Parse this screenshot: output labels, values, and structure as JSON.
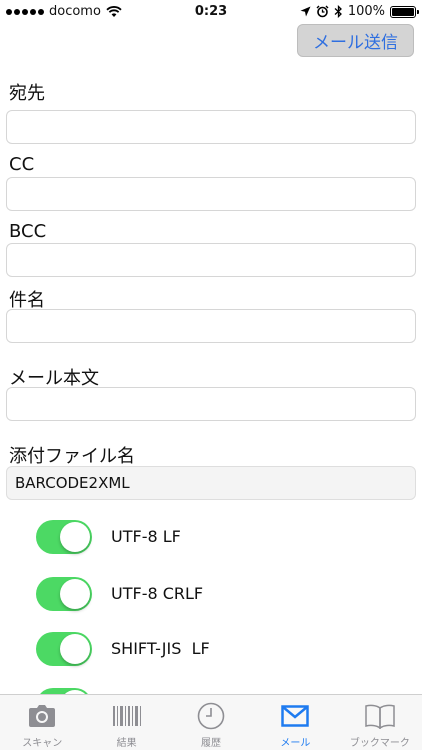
{
  "status_bar": {
    "carrier": "docomo",
    "time": "0:23",
    "battery": "100%",
    "battery_level": 1.0
  },
  "send_button": "メール送信",
  "form": {
    "to_label": "宛先",
    "cc_label": "CC",
    "bcc_label": "BCC",
    "subject_label": "件名",
    "body_label": "メール本文",
    "attachment_label": "添付ファイル名",
    "attachment_value": "BARCODE2XML"
  },
  "toggles": [
    {
      "label": "UTF-8 LF",
      "on": true
    },
    {
      "label": "UTF-8 CRLF",
      "on": true
    },
    {
      "label": "SHIFT-JIS  LF",
      "on": true
    }
  ],
  "tabs": [
    {
      "label": "スキャン",
      "icon": "camera-icon",
      "active": false
    },
    {
      "label": "結果",
      "icon": "barcode-icon",
      "active": false
    },
    {
      "label": "履歴",
      "icon": "clock-icon",
      "active": false
    },
    {
      "label": "メール",
      "icon": "mail-icon",
      "active": true
    },
    {
      "label": "ブックマーク",
      "icon": "book-icon",
      "active": false
    }
  ],
  "colors": {
    "accent": "#1e7bf0",
    "toggle_on": "#4cd964",
    "inactive": "#8e8e93"
  }
}
